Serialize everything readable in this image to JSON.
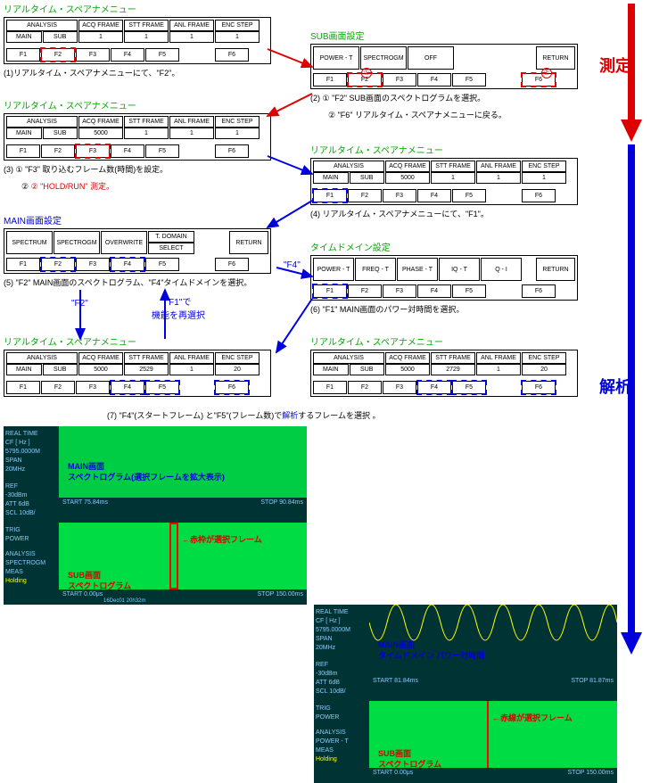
{
  "titles": {
    "rt_spana": "リアルタイム・スペアナメニュー",
    "sub_setting": "SUB画面設定",
    "main_setting": "MAIN画面設定",
    "time_domain": "タイムドメイン設定"
  },
  "hdr": {
    "analysis": "ANALYSIS",
    "acq": "ACQ FRAME",
    "stt": "STT FRAME",
    "anl": "ANL FRAME",
    "enc": "ENC STEP",
    "main": "MAIN",
    "sub": "SUB",
    "return": "RETURN"
  },
  "fkeys": {
    "f1": "F1",
    "f2": "F2",
    "f3": "F3",
    "f4": "F4",
    "f5": "F5",
    "f6": "F6"
  },
  "panel1": {
    "acq": "1",
    "stt": "1",
    "anl": "1",
    "enc": "1"
  },
  "cap1": "(1)リアルタイム・スペアナメニューにて、\"F2\"。",
  "panel2": {
    "c1": "POWER - T",
    "c2": "SPECTROGM",
    "c3": "OFF"
  },
  "cap2a": "(2) ① \"F2\" SUB画面のスペクトログラムを選択。",
  "cap2b": "② \"F6\" リアルタイム・スペアナメニューに戻る。",
  "panel3": {
    "acq": "5000",
    "stt": "1",
    "anl": "1",
    "enc": "1"
  },
  "cap3a": "(3) ① \"F3\" 取り込むフレーム数(時間)を設定。",
  "cap3b": "② \"HOLD/RUN\" 測定。",
  "panel4": {
    "acq": "5000",
    "stt": "1",
    "anl": "1",
    "enc": "1"
  },
  "cap4": "(4) リアルタイム・スペアナメニューにて、\"F1\"。",
  "panel5": {
    "c1": "SPECTRUM",
    "c2": "SPECTROGM",
    "c3": "OVERWRITE",
    "c4": "T. DOMAIN",
    "c4b": "SELECT"
  },
  "cap5": "(5) \"F2\" MAIN画面のスペクトログラム、\"F4\"タイムドメインを選択。",
  "panel6": {
    "c1": "POWER - T",
    "c2": "FREQ - T",
    "c3": "PHASE - T",
    "c4": "IQ - T",
    "c5": "Q - I"
  },
  "cap6": "(6) \"F1\" MAIN画面のパワー対時間を選択。",
  "panel7a": {
    "acq": "5000",
    "stt": "2529",
    "anl": "1",
    "enc": "20"
  },
  "panel7b": {
    "acq": "5000",
    "stt": "2729",
    "anl": "1",
    "enc": "20"
  },
  "cap7": "(7) \"F4\"(スタートフレーム) と\"F5\"(フレーム数)で解析するフレームを選択 。",
  "arrow_labels": {
    "f2": "\"F2\"",
    "f4": "\"F4\"",
    "f1_reselect": "\"F1\"で\n機能を再選択"
  },
  "side_labels": {
    "sokutei": "測定",
    "kaiseki": "解析"
  },
  "ss_side": {
    "realtime": "REAL TIME",
    "cf": "CF  [ Hz ]",
    "cfv": "5795.0000M",
    "span": "SPAN",
    "spanv": "  20MHz",
    "ref": "REF",
    "refv": " -30dBm",
    "att": "ATT  6dB",
    "scl": "SCL 10dB/",
    "trig": "TRIG",
    "trigv": "POWER",
    "ana": "ANALYSIS",
    "anav1": "SPECTROGM",
    "anav2": "POWER - T",
    "meas": "MEAS",
    "hold": "Holding"
  },
  "ss_left": {
    "top_label1": "MAIN画面",
    "top_label2": "スペクトログラム(選択フレームを拡大表示)",
    "start1": "START 75.84ms",
    "stop1": "STOP 90.84ms",
    "bot_label1": "SUB画面",
    "bot_label2": "スペクトログラム",
    "frame_label": "←赤枠が選択フレーム",
    "start2": "START 0.00μs",
    "stop2": "STOP 150.00ms",
    "ts": "16Dec01 20h32m"
  },
  "ss_right": {
    "top_label1": "MAIN画面",
    "top_label2": "タイムドメイン パワー対時間",
    "start1": "START 81.84ms",
    "stop1": "STOP 81.87ms",
    "bot_label1": "SUB画面",
    "bot_label2": "スペクトログラム",
    "frame_label": "←赤線が選択フレーム",
    "start2": "START 0.00μs",
    "stop2": "STOP 150.00ms"
  }
}
